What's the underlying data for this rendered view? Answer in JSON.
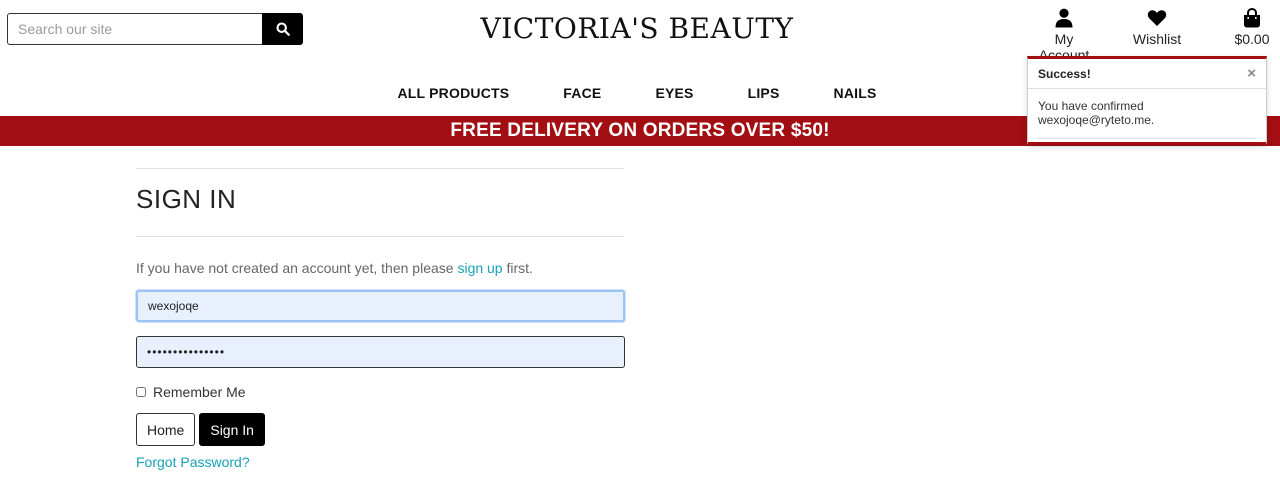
{
  "search": {
    "placeholder": "Search our site"
  },
  "brand": {
    "logo": "VICTORIA'S BEAUTY"
  },
  "account_nav": {
    "account_label": "My Account",
    "wishlist_label": "Wishlist",
    "bag_total": "$0.00"
  },
  "nav": {
    "items": [
      "ALL PRODUCTS",
      "FACE",
      "EYES",
      "LIPS",
      "NAILS"
    ]
  },
  "banner": {
    "text": "FREE DELIVERY ON ORDERS OVER $50!"
  },
  "toast": {
    "title": "Success!",
    "message": "You have confirmed wexojoqe@ryteto.me.",
    "close_glyph": "×"
  },
  "signin": {
    "heading": "SIGN IN",
    "intro_before": "If you have not created an account yet, then please ",
    "signup_link": "sign up",
    "intro_after": " first.",
    "username_value": "wexojoqe",
    "password_value": "•••••••••••••••",
    "remember_label": "Remember Me",
    "home_button": "Home",
    "signin_button": "Sign In",
    "forgot_link": "Forgot Password?"
  },
  "colors": {
    "brand_red": "#a20e12",
    "link": "#17a2b8",
    "autofill_bg": "#e8f0fe"
  },
  "icons": [
    "search-icon",
    "user-icon",
    "heart-icon",
    "shopping-bag-icon",
    "close-icon"
  ]
}
